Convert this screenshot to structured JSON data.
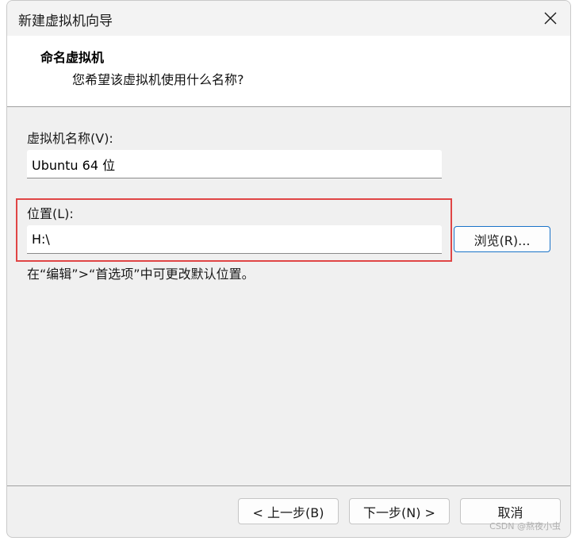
{
  "window": {
    "title": "新建虚拟机向导"
  },
  "header": {
    "title": "命名虚拟机",
    "subtitle": "您希望该虚拟机使用什么名称?"
  },
  "vm_name": {
    "label": "虚拟机名称(V):",
    "value": "Ubuntu 64 位"
  },
  "location": {
    "label": "位置(L):",
    "value": "H:\\",
    "browse_label": "浏览(R)..."
  },
  "hint": "在“编辑”>“首选项”中可更改默认位置。",
  "footer": {
    "back_label": "< 上一步(B)",
    "next_label": "下一步(N) >",
    "cancel_label": "取消"
  },
  "watermark": "CSDN @熬夜小虫",
  "colors": {
    "highlight": "#e04545",
    "focus_border": "#1a73c8"
  },
  "icons": {
    "close": "close-icon"
  }
}
